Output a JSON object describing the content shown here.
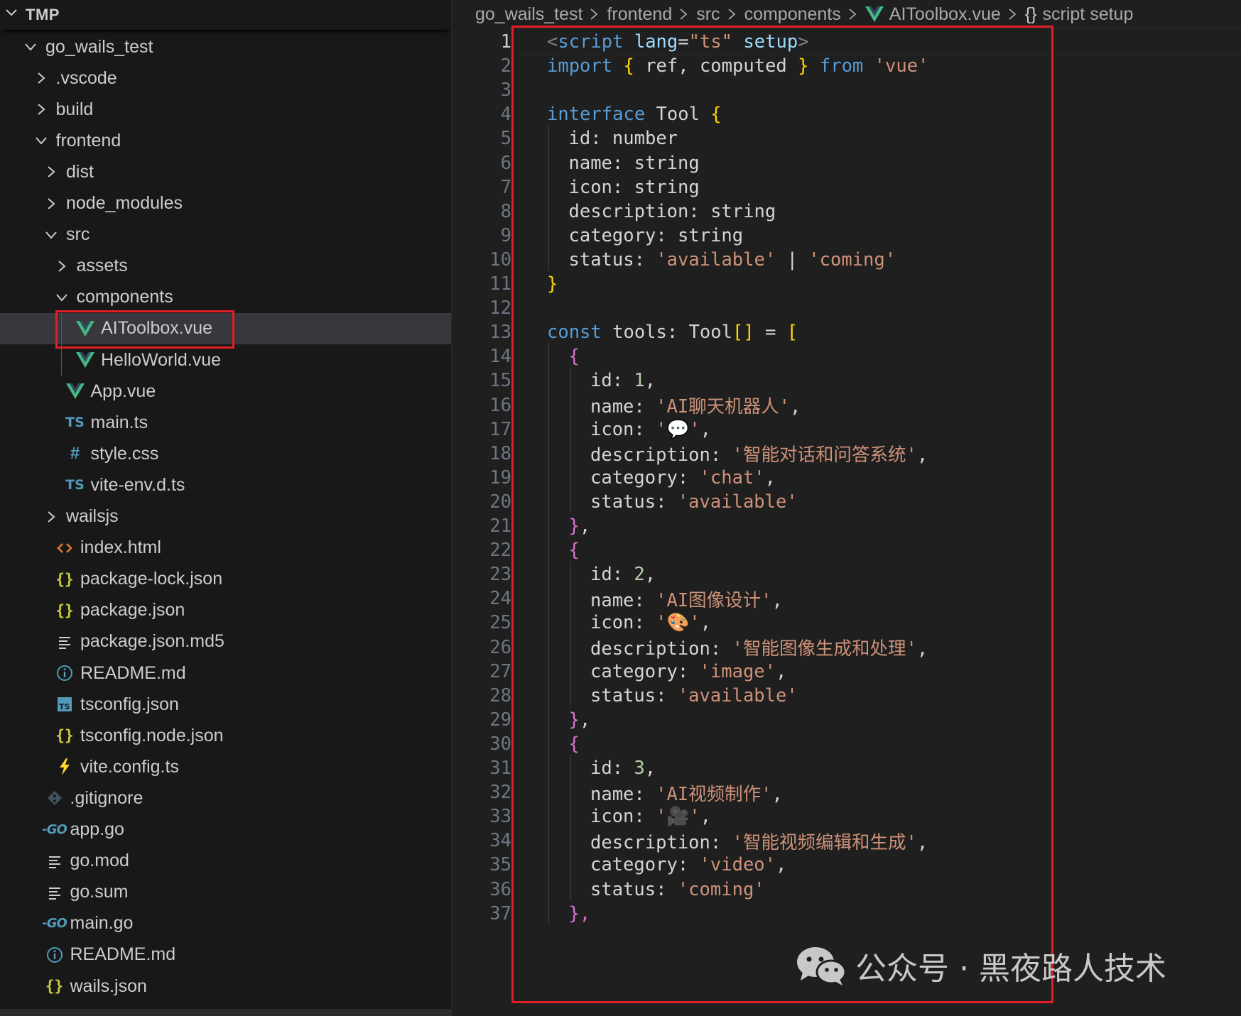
{
  "explorer": {
    "section_title": "TMP",
    "items": [
      {
        "label": "go_wails_test",
        "kind": "folder",
        "open": true,
        "depth": 1,
        "icon": "folder"
      },
      {
        "label": ".vscode",
        "kind": "folder",
        "open": false,
        "depth": 2,
        "icon": "folder"
      },
      {
        "label": "build",
        "kind": "folder",
        "open": false,
        "depth": 2,
        "icon": "folder"
      },
      {
        "label": "frontend",
        "kind": "folder",
        "open": true,
        "depth": 2,
        "icon": "folder"
      },
      {
        "label": "dist",
        "kind": "folder",
        "open": false,
        "depth": 3,
        "icon": "folder"
      },
      {
        "label": "node_modules",
        "kind": "folder",
        "open": false,
        "depth": 3,
        "icon": "folder"
      },
      {
        "label": "src",
        "kind": "folder",
        "open": true,
        "depth": 3,
        "icon": "folder"
      },
      {
        "label": "assets",
        "kind": "folder",
        "open": false,
        "depth": 4,
        "icon": "folder"
      },
      {
        "label": "components",
        "kind": "folder",
        "open": true,
        "depth": 4,
        "icon": "folder"
      },
      {
        "label": "AIToolbox.vue",
        "kind": "file",
        "depth": 5,
        "icon": "vue",
        "selected": true
      },
      {
        "label": "HelloWorld.vue",
        "kind": "file",
        "depth": 5,
        "icon": "vue"
      },
      {
        "label": "App.vue",
        "kind": "file",
        "depth": 4,
        "icon": "vue"
      },
      {
        "label": "main.ts",
        "kind": "file",
        "depth": 4,
        "icon": "ts"
      },
      {
        "label": "style.css",
        "kind": "file",
        "depth": 4,
        "icon": "css"
      },
      {
        "label": "vite-env.d.ts",
        "kind": "file",
        "depth": 4,
        "icon": "ts"
      },
      {
        "label": "wailsjs",
        "kind": "folder",
        "open": false,
        "depth": 3,
        "icon": "folder"
      },
      {
        "label": "index.html",
        "kind": "file",
        "depth": 3,
        "icon": "html"
      },
      {
        "label": "package-lock.json",
        "kind": "file",
        "depth": 3,
        "icon": "json"
      },
      {
        "label": "package.json",
        "kind": "file",
        "depth": 3,
        "icon": "json"
      },
      {
        "label": "package.json.md5",
        "kind": "file",
        "depth": 3,
        "icon": "lines"
      },
      {
        "label": "README.md",
        "kind": "file",
        "depth": 3,
        "icon": "info"
      },
      {
        "label": "tsconfig.json",
        "kind": "file",
        "depth": 3,
        "icon": "tsconfig"
      },
      {
        "label": "tsconfig.node.json",
        "kind": "file",
        "depth": 3,
        "icon": "json"
      },
      {
        "label": "vite.config.ts",
        "kind": "file",
        "depth": 3,
        "icon": "vite"
      },
      {
        "label": ".gitignore",
        "kind": "file",
        "depth": 2,
        "icon": "git"
      },
      {
        "label": "app.go",
        "kind": "file",
        "depth": 2,
        "icon": "go"
      },
      {
        "label": "go.mod",
        "kind": "file",
        "depth": 2,
        "icon": "lines"
      },
      {
        "label": "go.sum",
        "kind": "file",
        "depth": 2,
        "icon": "lines"
      },
      {
        "label": "main.go",
        "kind": "file",
        "depth": 2,
        "icon": "go"
      },
      {
        "label": "README.md",
        "kind": "file",
        "depth": 2,
        "icon": "info"
      },
      {
        "label": "wails.json",
        "kind": "file",
        "depth": 2,
        "icon": "json"
      }
    ]
  },
  "breadcrumb": {
    "parts": [
      "go_wails_test",
      "frontend",
      "src",
      "components"
    ],
    "file": "AIToolbox.vue",
    "symbol_icon": "{}",
    "symbol": "script setup"
  },
  "editor": {
    "active_line": 1,
    "lines": [
      {
        "n": "1",
        "indent": 0,
        "tokens": [
          [
            "tag",
            "<"
          ],
          [
            "tagname",
            "script"
          ],
          [
            "id",
            " "
          ],
          [
            "attr",
            "lang"
          ],
          [
            "id",
            "="
          ],
          [
            "str",
            "\"ts\""
          ],
          [
            "id",
            " "
          ],
          [
            "attr",
            "setup"
          ],
          [
            "tag",
            ">"
          ]
        ]
      },
      {
        "n": "2",
        "indent": 0,
        "tokens": [
          [
            "kw",
            "import"
          ],
          [
            "id",
            " "
          ],
          [
            "b1",
            "{"
          ],
          [
            "id",
            " ref, computed "
          ],
          [
            "b1",
            "}"
          ],
          [
            "id",
            " "
          ],
          [
            "kw",
            "from"
          ],
          [
            "id",
            " "
          ],
          [
            "str",
            "'vue'"
          ]
        ]
      },
      {
        "n": "3",
        "indent": 0,
        "tokens": []
      },
      {
        "n": "4",
        "indent": 0,
        "tokens": [
          [
            "kw",
            "interface"
          ],
          [
            "id",
            " Tool "
          ],
          [
            "b1",
            "{"
          ]
        ]
      },
      {
        "n": "5",
        "indent": 1,
        "tokens": [
          [
            "id",
            "id: number"
          ]
        ]
      },
      {
        "n": "6",
        "indent": 1,
        "tokens": [
          [
            "id",
            "name: string"
          ]
        ]
      },
      {
        "n": "7",
        "indent": 1,
        "tokens": [
          [
            "id",
            "icon: string"
          ]
        ]
      },
      {
        "n": "8",
        "indent": 1,
        "tokens": [
          [
            "id",
            "description: string"
          ]
        ]
      },
      {
        "n": "9",
        "indent": 1,
        "tokens": [
          [
            "id",
            "category: string"
          ]
        ]
      },
      {
        "n": "10",
        "indent": 1,
        "tokens": [
          [
            "id",
            "status: "
          ],
          [
            "str",
            "'available'"
          ],
          [
            "id",
            " | "
          ],
          [
            "str",
            "'coming'"
          ]
        ]
      },
      {
        "n": "11",
        "indent": 0,
        "tokens": [
          [
            "b1",
            "}"
          ]
        ]
      },
      {
        "n": "12",
        "indent": 0,
        "tokens": []
      },
      {
        "n": "13",
        "indent": 0,
        "tokens": [
          [
            "kw",
            "const"
          ],
          [
            "id",
            " tools: Tool"
          ],
          [
            "b1",
            "[]"
          ],
          [
            "id",
            " = "
          ],
          [
            "b1",
            "["
          ]
        ]
      },
      {
        "n": "14",
        "indent": 1,
        "tokens": [
          [
            "b2",
            "{"
          ]
        ]
      },
      {
        "n": "15",
        "indent": 2,
        "tokens": [
          [
            "id",
            "id: "
          ],
          [
            "num",
            "1"
          ],
          [
            "id",
            ","
          ]
        ]
      },
      {
        "n": "16",
        "indent": 2,
        "tokens": [
          [
            "id",
            "name: "
          ],
          [
            "str",
            "'AI聊天机器人'"
          ],
          [
            "id",
            ","
          ]
        ]
      },
      {
        "n": "17",
        "indent": 2,
        "tokens": [
          [
            "id",
            "icon: "
          ],
          [
            "str",
            "'💬'"
          ],
          [
            "id",
            ","
          ]
        ]
      },
      {
        "n": "18",
        "indent": 2,
        "tokens": [
          [
            "id",
            "description: "
          ],
          [
            "str",
            "'智能对话和问答系统'"
          ],
          [
            "id",
            ","
          ]
        ]
      },
      {
        "n": "19",
        "indent": 2,
        "tokens": [
          [
            "id",
            "category: "
          ],
          [
            "str",
            "'chat'"
          ],
          [
            "id",
            ","
          ]
        ]
      },
      {
        "n": "20",
        "indent": 2,
        "tokens": [
          [
            "id",
            "status: "
          ],
          [
            "str",
            "'available'"
          ]
        ]
      },
      {
        "n": "21",
        "indent": 1,
        "tokens": [
          [
            "b2",
            "}"
          ],
          [
            "id",
            ","
          ]
        ]
      },
      {
        "n": "22",
        "indent": 1,
        "tokens": [
          [
            "b2",
            "{"
          ]
        ]
      },
      {
        "n": "23",
        "indent": 2,
        "tokens": [
          [
            "id",
            "id: "
          ],
          [
            "num",
            "2"
          ],
          [
            "id",
            ","
          ]
        ]
      },
      {
        "n": "24",
        "indent": 2,
        "tokens": [
          [
            "id",
            "name: "
          ],
          [
            "str",
            "'AI图像设计'"
          ],
          [
            "id",
            ","
          ]
        ]
      },
      {
        "n": "25",
        "indent": 2,
        "tokens": [
          [
            "id",
            "icon: "
          ],
          [
            "str",
            "'🎨'"
          ],
          [
            "id",
            ","
          ]
        ]
      },
      {
        "n": "26",
        "indent": 2,
        "tokens": [
          [
            "id",
            "description: "
          ],
          [
            "str",
            "'智能图像生成和处理'"
          ],
          [
            "id",
            ","
          ]
        ]
      },
      {
        "n": "27",
        "indent": 2,
        "tokens": [
          [
            "id",
            "category: "
          ],
          [
            "str",
            "'image'"
          ],
          [
            "id",
            ","
          ]
        ]
      },
      {
        "n": "28",
        "indent": 2,
        "tokens": [
          [
            "id",
            "status: "
          ],
          [
            "str",
            "'available'"
          ]
        ]
      },
      {
        "n": "29",
        "indent": 1,
        "tokens": [
          [
            "b2",
            "}"
          ],
          [
            "id",
            ","
          ]
        ]
      },
      {
        "n": "30",
        "indent": 1,
        "tokens": [
          [
            "b2",
            "{"
          ]
        ]
      },
      {
        "n": "31",
        "indent": 2,
        "tokens": [
          [
            "id",
            "id: "
          ],
          [
            "num",
            "3"
          ],
          [
            "id",
            ","
          ]
        ]
      },
      {
        "n": "32",
        "indent": 2,
        "tokens": [
          [
            "id",
            "name: "
          ],
          [
            "str",
            "'AI视频制作'"
          ],
          [
            "id",
            ","
          ]
        ]
      },
      {
        "n": "33",
        "indent": 2,
        "tokens": [
          [
            "id",
            "icon: "
          ],
          [
            "str",
            "'🎥'"
          ],
          [
            "id",
            ","
          ]
        ]
      },
      {
        "n": "34",
        "indent": 2,
        "tokens": [
          [
            "id",
            "description: "
          ],
          [
            "str",
            "'智能视频编辑和生成'"
          ],
          [
            "id",
            ","
          ]
        ]
      },
      {
        "n": "35",
        "indent": 2,
        "tokens": [
          [
            "id",
            "category: "
          ],
          [
            "str",
            "'video'"
          ],
          [
            "id",
            ","
          ]
        ]
      },
      {
        "n": "36",
        "indent": 2,
        "tokens": [
          [
            "id",
            "status: "
          ],
          [
            "str",
            "'coming'"
          ]
        ]
      },
      {
        "n": "37",
        "indent": 1,
        "tokens": [
          [
            "b2",
            "},"
          ]
        ]
      }
    ]
  },
  "watermark": {
    "text": "公众号 · 黑夜路人技术"
  },
  "colors": {
    "highlight_box": "#e01f26",
    "vue_green": "#42b883",
    "ts_blue": "#519aba",
    "json_yellow": "#cbcb41",
    "html_orange": "#e37933",
    "go_blue": "#519aba"
  }
}
